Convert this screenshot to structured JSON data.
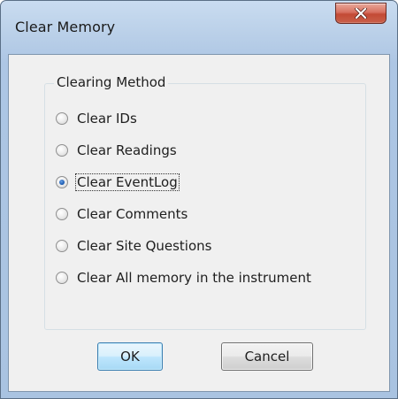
{
  "window": {
    "title": "Clear Memory"
  },
  "icons": {
    "close": "close-icon"
  },
  "group": {
    "label": "Clearing Method",
    "options": [
      {
        "label": "Clear IDs",
        "checked": false
      },
      {
        "label": "Clear Readings",
        "checked": false
      },
      {
        "label": "Clear EventLog",
        "checked": true
      },
      {
        "label": "Clear Comments",
        "checked": false
      },
      {
        "label": "Clear Site Questions",
        "checked": false
      },
      {
        "label": "Clear All memory in the instrument",
        "checked": false
      }
    ]
  },
  "buttons": {
    "ok": "OK",
    "cancel": "Cancel"
  },
  "colors": {
    "accent": "#3c7fb1",
    "close": "#c34a35",
    "face": "#f0f0f0"
  }
}
